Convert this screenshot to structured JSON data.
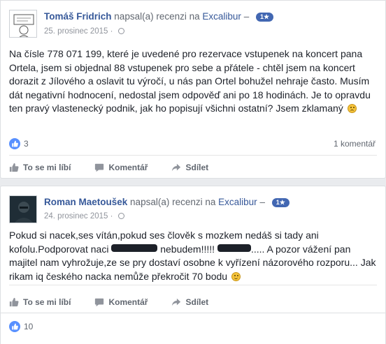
{
  "reviews": [
    {
      "author": "Tomáš Fridrich",
      "verb": "napsal(a) recenzi na",
      "page": "Excalibur",
      "separator": "–",
      "badge": "1★",
      "date": "25. prosinec 2015",
      "date_sep": "·",
      "text": "Na čísle 778 071 199, které je uvedené pro rezervace vstupenek na koncert pana Ortela, jsem si objednal 88 vstupenek pro sebe a přátele - chtěl jsem na koncert dorazit z Jílového a oslavit tu výročí, u nás pan Ortel bohužel nehraje často. Musím dát negativní hodnocení, nedostal jsem odpověď ani po 18 hodinách. Je to opravdu ten pravý vlastenecký podnik, jak ho popisují všichni ostatní? Jsem zklamaný",
      "likes": "3",
      "comments": "1 komentář",
      "actions": {
        "like": "To se mi líbí",
        "comment": "Komentář",
        "share": "Sdílet"
      }
    },
    {
      "author": "Roman Maetoušek",
      "verb": "napsal(a) recenzi na",
      "page": "Excalibur",
      "separator": "–",
      "badge": "1★",
      "date": "24. prosinec 2015",
      "date_sep": "·",
      "text_part1": "Pokud si nacek,ses vítán,pokud ses člověk s mozkem nedáš si tady ani kofolu.Podporovat naci",
      "text_part2": "nebudem!!!!!",
      "text_part3": "..... A pozor vážení pan majitel nam vyhrožuje,ze se pry dostaví osobne k vyřízení názorového rozporu... Jak rikam iq českého nacka nemůže překročit 70 bodu",
      "likes": "10",
      "actions": {
        "like": "To se mi líbí",
        "comment": "Komentář",
        "share": "Sdílet"
      }
    }
  ]
}
